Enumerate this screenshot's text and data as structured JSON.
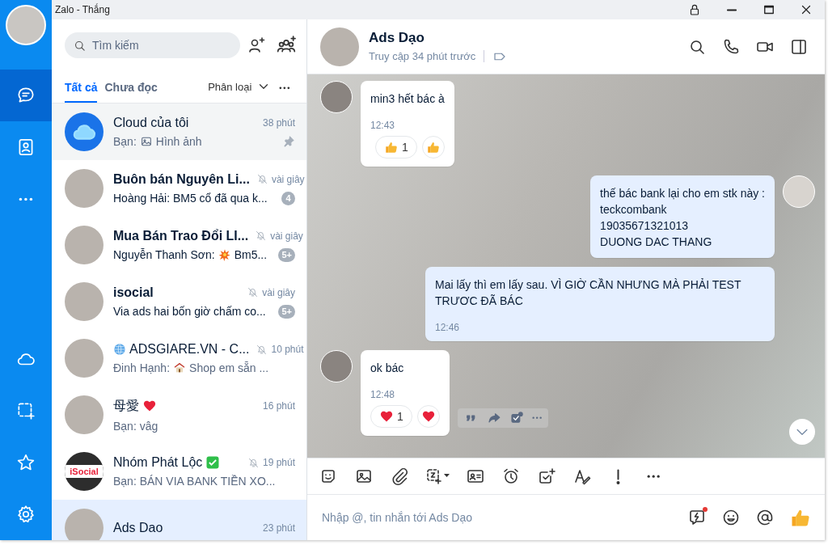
{
  "window": {
    "title": "Zalo - Thắng"
  },
  "nav": {
    "top_items": [
      {
        "kind": "chat",
        "selected": true
      },
      {
        "kind": "contacts",
        "selected": false
      },
      {
        "kind": "more",
        "selected": false
      }
    ],
    "bottom_items": [
      {
        "kind": "cloud",
        "selected": false
      },
      {
        "kind": "screenshot",
        "selected": false
      },
      {
        "kind": "star",
        "selected": false
      },
      {
        "kind": "settings",
        "selected": false
      }
    ]
  },
  "search": {
    "placeholder": "Tìm kiếm"
  },
  "filters": {
    "tabs": [
      {
        "label": "Tất cả",
        "selected": true
      },
      {
        "label": "Chưa đọc",
        "selected": false
      }
    ],
    "classify": "Phân loại"
  },
  "conversations": [
    {
      "name": "Cloud của tôi",
      "avatar": {
        "kind": "cloud"
      },
      "preview_author": "Bạn:",
      "preview_icon": {
        "kind": "image"
      },
      "preview": "Hình ảnh",
      "time": "38 phút",
      "unread": false,
      "muted": false,
      "pinned": true,
      "hovered": true,
      "selected": false
    },
    {
      "name": "Buôn bán Nguyên Li...",
      "avatar": {
        "kind": "photo"
      },
      "preview": "Hoàng Hải: BM5 cổ đã qua k...",
      "time": "vài giây",
      "badge": "4",
      "unread": true,
      "muted": true,
      "pinned": false,
      "hovered": false,
      "selected": false
    },
    {
      "name": "Mua Bán Trao Đổi LI...",
      "avatar": {
        "kind": "photo"
      },
      "preview_author": "Nguyễn Thanh Sơn:",
      "preview_icon": {
        "kind": "burst"
      },
      "preview": "Bm5...",
      "time": "vài giây",
      "badge": "5+",
      "unread": true,
      "muted": true,
      "pinned": false,
      "hovered": false,
      "selected": false
    },
    {
      "name": "isocial",
      "avatar": {
        "kind": "photo"
      },
      "preview": "Via ads hai bốn giờ chấm co...",
      "time": "vài giây",
      "badge": "5+",
      "unread": true,
      "muted": true,
      "pinned": false,
      "hovered": false,
      "selected": false
    },
    {
      "name_icon": {
        "kind": "globe"
      },
      "name": "ADSGIARE.VN - C...",
      "avatar": {
        "kind": "photo"
      },
      "preview_author": "Đinh Hạnh:",
      "preview_icon": {
        "kind": "house"
      },
      "preview": "Shop em sẵn ...",
      "time": "10 phút",
      "unread": false,
      "muted": true,
      "pinned": false,
      "hovered": false,
      "selected": false
    },
    {
      "name": "母愛",
      "name_badge": {
        "kind": "heart"
      },
      "avatar": {
        "kind": "photo"
      },
      "preview": "Bạn: vâg",
      "time": "16 phút",
      "unread": false,
      "muted": false,
      "pinned": false,
      "hovered": false,
      "selected": false
    },
    {
      "name": "Nhóm Phát Lộc",
      "name_badge": {
        "kind": "verified"
      },
      "avatar": {
        "kind": "logo",
        "text": "iSocial"
      },
      "preview": "Bạn: BÁN VIA BANK TIỀN XO...",
      "time": "19 phút",
      "unread": false,
      "muted": true,
      "pinned": false,
      "hovered": false,
      "selected": false
    },
    {
      "name": "Ads Dao",
      "avatar": {
        "kind": "photo"
      },
      "time": "23 phút",
      "unread": false,
      "muted": false,
      "pinned": false,
      "hovered": false,
      "selected": true
    }
  ],
  "chat": {
    "name": "Ads Dạo",
    "status": "Truy cập 34 phút trước",
    "messages": [
      {
        "kind": "incoming",
        "show_avatar": true,
        "text": "min3 hết bác à",
        "time": "12:43",
        "reactions": [
          {
            "kind": "like",
            "count": "1"
          }
        ],
        "react_button": {
          "kind": "like"
        },
        "hover_actions": false
      },
      {
        "kind": "outgoing",
        "show_avatar": true,
        "text": "thế bác bank lại cho em stk này :\nteckcombank\n19035671321013\nDUONG DAC THANG",
        "hover_actions": false
      },
      {
        "kind": "outgoing",
        "show_avatar": false,
        "text": "Mai lấy thì em lấy sau. VÌ GIỜ CẦN NHƯNG MÀ PHẢI TEST TRƯƠC ĐÃ BÁC",
        "time": "12:46",
        "hover_actions": false
      },
      {
        "kind": "incoming",
        "show_avatar": true,
        "text": "ok bác",
        "time": "12:48",
        "reactions": [
          {
            "kind": "heart",
            "count": "1"
          }
        ],
        "react_button": {
          "kind": "heart"
        },
        "hover_actions": true
      }
    ],
    "toolbar": [
      {
        "kind": "sticker"
      },
      {
        "kind": "image"
      },
      {
        "kind": "attach"
      },
      {
        "kind": "screenshot"
      },
      {
        "kind": "contact-card"
      },
      {
        "kind": "reminder"
      },
      {
        "kind": "task"
      },
      {
        "kind": "text-format"
      },
      {
        "kind": "important"
      },
      {
        "kind": "more"
      }
    ],
    "composer": {
      "placeholder": "Nhập @, tin nhắn tới Ads Dạo",
      "actions": [
        {
          "kind": "quick-message",
          "dot": true
        },
        {
          "kind": "emoji",
          "dot": false
        },
        {
          "kind": "mention",
          "dot": false
        },
        {
          "kind": "like",
          "dot": false
        }
      ]
    }
  }
}
